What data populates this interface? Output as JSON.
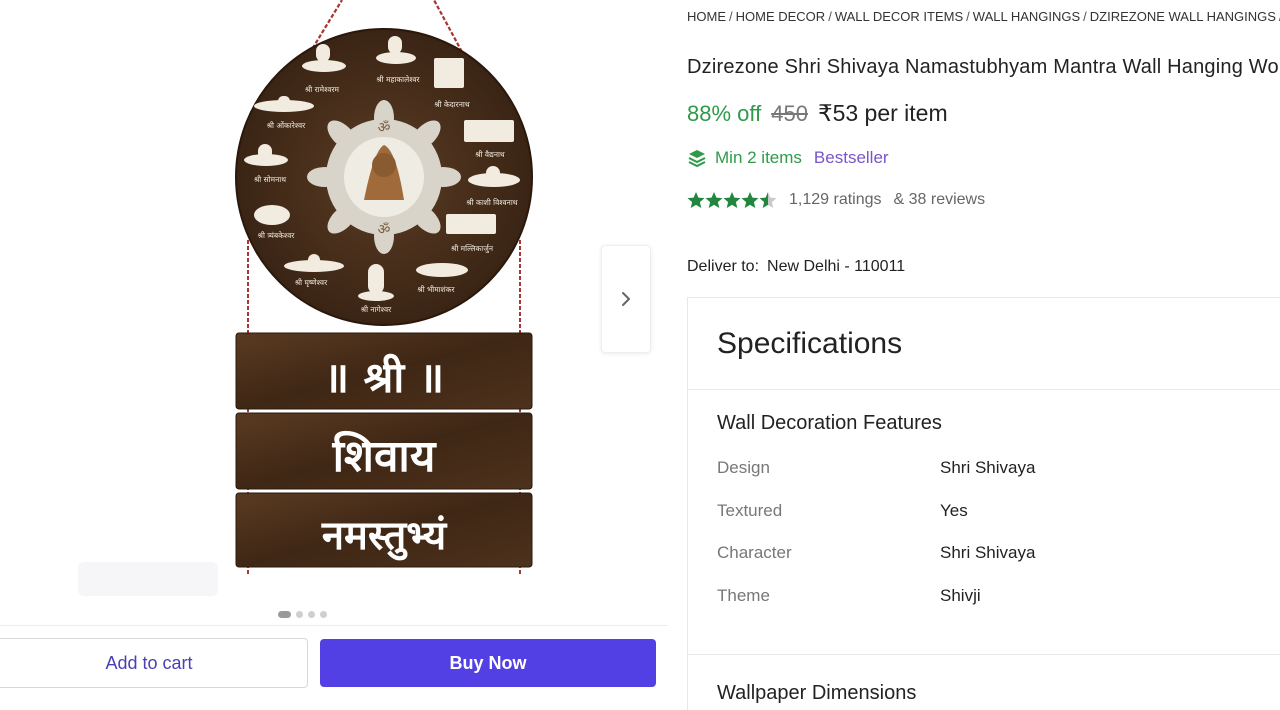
{
  "gallery": {
    "art": {
      "shri": "॥ श्री ॥",
      "shivaya": "शिवाय",
      "namastubhyam": "नमस्तुभ्यं",
      "om": "ॐ",
      "circle_labels": [
        "श्री रामेश्वरम",
        "श्री महाकालेश्वर",
        "श्री केदारनाथ",
        "श्री ओंकारेश्वर",
        "श्री वैद्यनाथ",
        "श्री सोमनाथ",
        "श्री काशी विश्वनाथ",
        "श्री त्र्यंबकेश्वर",
        "श्री मल्लिकार्जुन",
        "श्री घृष्णेश्वर",
        "श्री नागेश्वर",
        "श्री भीमाशंकर"
      ]
    },
    "next_icon": "chevron-right-icon",
    "dots": 4,
    "active_dot": 0
  },
  "actions": {
    "add_to_cart": "Add to cart",
    "buy_now": "Buy Now",
    "buy_color": "#5340e5"
  },
  "breadcrumb": [
    "HOME",
    "HOME DECOR",
    "WALL DECOR ITEMS",
    "WALL HANGINGS",
    "DZIREZONE WALL HANGINGS",
    "DZ"
  ],
  "product": {
    "title": "Dzirezone Shri Shivaya Namastubhyam Mantra Wall Hanging Wo",
    "discount": "88% off",
    "mrp": "450",
    "price": "₹53 per item",
    "min_items": "Min 2 items",
    "badge": "Bestseller",
    "rating_value": 4.5,
    "ratings_count": "1,129 ratings",
    "reviews_count": "& 38 reviews",
    "accent_green": "#2e9a4a"
  },
  "delivery": {
    "label": "Deliver to:",
    "location": "New Delhi - 110011"
  },
  "specs": {
    "heading": "Specifications",
    "section_title": "Wall Decoration Features",
    "rows": [
      {
        "key": "Design",
        "value": "Shri Shivaya"
      },
      {
        "key": "Textured",
        "value": "Yes"
      },
      {
        "key": "Character",
        "value": "Shri Shivaya"
      },
      {
        "key": "Theme",
        "value": "Shivji"
      }
    ],
    "next_section_title": "Wallpaper Dimensions"
  }
}
